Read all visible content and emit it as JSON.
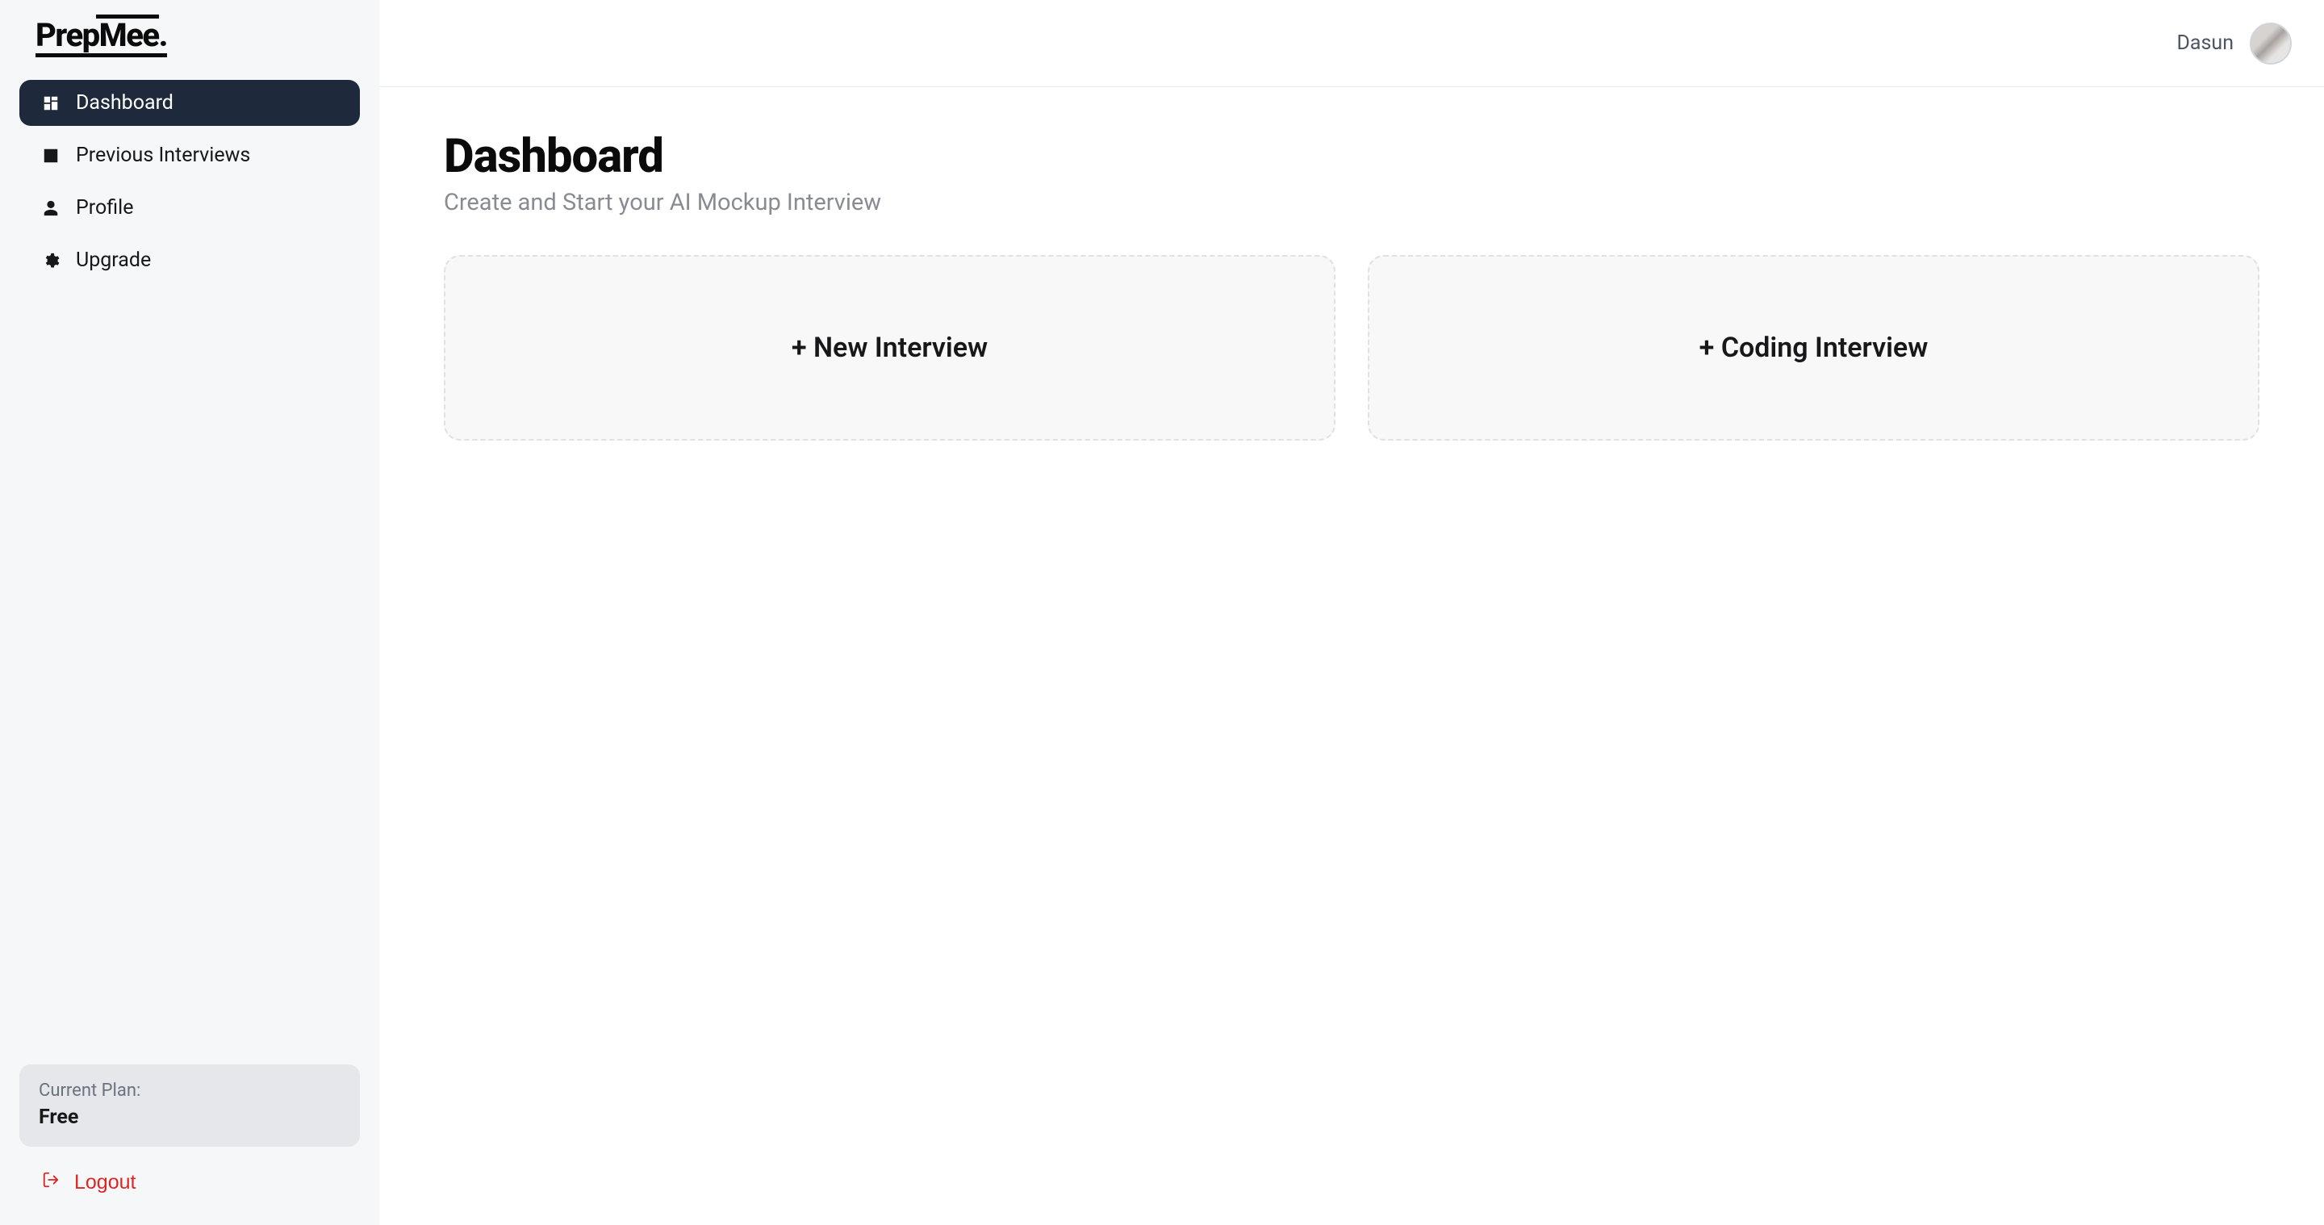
{
  "logo": "PrepMee.",
  "sidebar": {
    "items": [
      {
        "label": "Dashboard"
      },
      {
        "label": "Previous Interviews"
      },
      {
        "label": "Profile"
      },
      {
        "label": "Upgrade"
      }
    ],
    "plan": {
      "label": "Current Plan:",
      "value": "Free"
    },
    "logout": "Logout"
  },
  "header": {
    "username": "Dasun"
  },
  "main": {
    "title": "Dashboard",
    "subtitle": "Create and Start your AI Mockup Interview",
    "cards": [
      {
        "label": "+ New Interview"
      },
      {
        "label": "+ Coding Interview"
      }
    ]
  }
}
